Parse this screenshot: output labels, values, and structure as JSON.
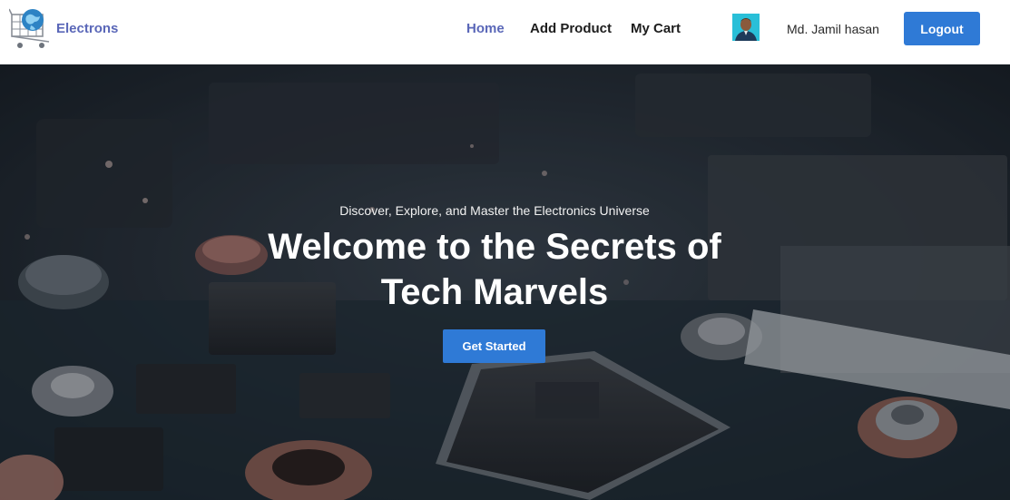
{
  "brand": {
    "name": "Electrons",
    "logo_icon": "globe-cart-icon"
  },
  "nav": {
    "items": [
      {
        "label": "Home",
        "active": true
      },
      {
        "label": "Add Product",
        "active": false
      },
      {
        "label": "My Cart",
        "active": false
      }
    ]
  },
  "user": {
    "name": "Md. Jamil hasan",
    "avatar_icon": "user-avatar"
  },
  "actions": {
    "logout_label": "Logout"
  },
  "hero": {
    "subtitle": "Discover, Explore, and Master the Electronics Universe",
    "title_line1": "Welcome to the Secrets of",
    "title_line2": "Tech Marvels",
    "cta_label": "Get Started"
  },
  "colors": {
    "accent": "#2f7ad6",
    "brand_text": "#5a67b8",
    "nav_text": "#1d1d1d",
    "hero_bg": "#1a2026"
  }
}
